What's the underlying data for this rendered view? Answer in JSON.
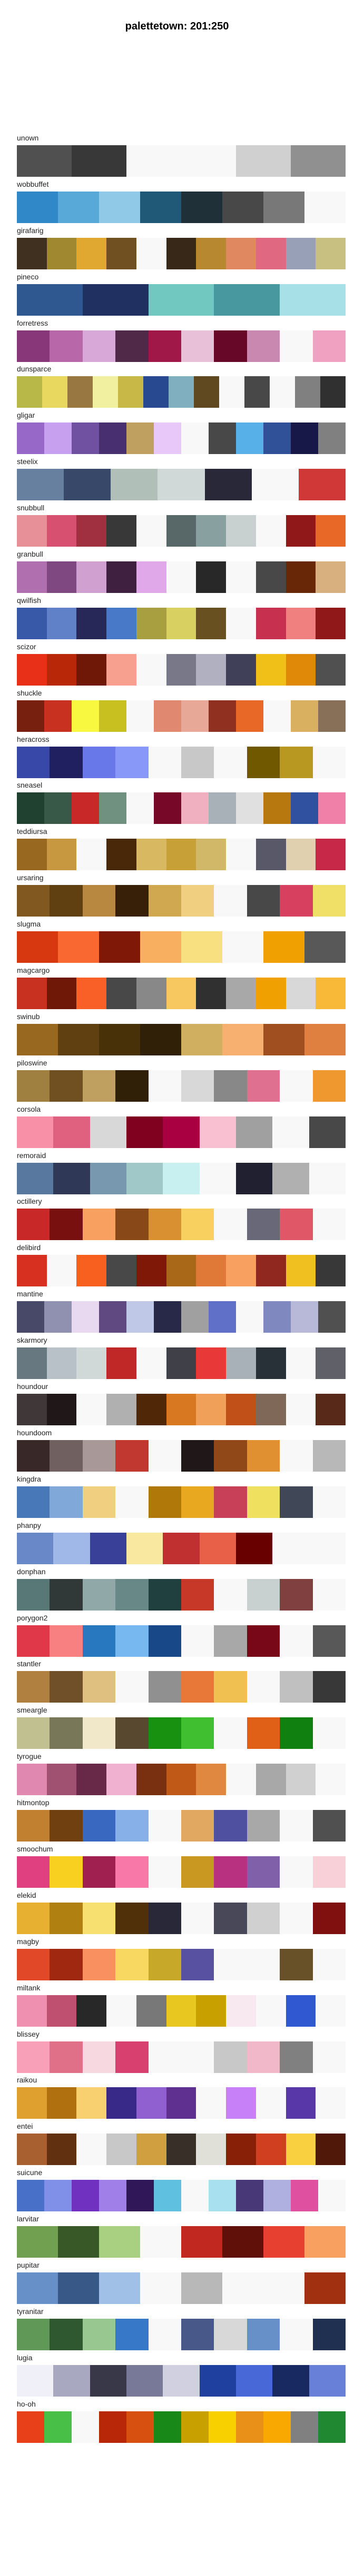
{
  "title": "palettetown: 201:250",
  "palettes": [
    {
      "name": "unown",
      "colors": [
        "#505050",
        "#383838",
        "#f8f8f8",
        "#f8f8f8",
        "#d0d0d0",
        "#909090"
      ]
    },
    {
      "name": "wobbuffet",
      "colors": [
        "#3088c8",
        "#58a8d8",
        "#90c8e8",
        "#205878",
        "#203038",
        "#484848",
        "#787878",
        "#f8f8f8"
      ]
    },
    {
      "name": "girafarig",
      "colors": [
        "#403020",
        "#a08830",
        "#e0a830",
        "#705020",
        "#f8f8f8",
        "#382818",
        "#b88830",
        "#e08860",
        "#e06880",
        "#98a0b8",
        "#c8c080"
      ]
    },
    {
      "name": "pineco",
      "colors": [
        "#305890",
        "#203060",
        "#70c8c0",
        "#4898a0",
        "#a8e0e8"
      ]
    },
    {
      "name": "forretress",
      "colors": [
        "#883878",
        "#b868a8",
        "#d8a8d8",
        "#502848",
        "#a01848",
        "#e8c0d8",
        "#680828",
        "#c888b0",
        "#f8f8f8",
        "#f0a0c0"
      ]
    },
    {
      "name": "dunsparce",
      "colors": [
        "#b8b848",
        "#e8d860",
        "#987840",
        "#f0f0a0",
        "#c8b848",
        "#284890",
        "#80b0c0",
        "#604820",
        "#f8f8f8",
        "#484848",
        "#f8f8f8",
        "#808080",
        "#303030"
      ]
    },
    {
      "name": "gligar",
      "colors": [
        "#9868c8",
        "#c8a0f0",
        "#7050a0",
        "#483070",
        "#c0a060",
        "#e8c8f8",
        "#f8f8f8",
        "#484848",
        "#58b0e8",
        "#305098",
        "#181848",
        "#808080"
      ]
    },
    {
      "name": "steelix",
      "colors": [
        "#6880a0",
        "#384868",
        "#b0c0b8",
        "#d0d8d8",
        "#282838",
        "#f8f8f8",
        "#d03838"
      ]
    },
    {
      "name": "snubbull",
      "colors": [
        "#e89098",
        "#d85070",
        "#a03040",
        "#383838",
        "#f8f8f8",
        "#586868",
        "#88a0a0",
        "#c8d0d0",
        "#f8f8f8",
        "#901818",
        "#e86828"
      ]
    },
    {
      "name": "granbull",
      "colors": [
        "#b070b0",
        "#804880",
        "#d0a0d0",
        "#402040",
        "#e0a8e8",
        "#f8f8f8",
        "#282828",
        "#f8f8f8",
        "#484848",
        "#682808",
        "#d8b080"
      ]
    },
    {
      "name": "qwilfish",
      "colors": [
        "#3858a8",
        "#6080c8",
        "#282858",
        "#4878c8",
        "#a8a040",
        "#d8d060",
        "#685020",
        "#f8f8f8",
        "#c83050",
        "#f08080",
        "#901818"
      ]
    },
    {
      "name": "scizor",
      "colors": [
        "#e83018",
        "#b82808",
        "#701808",
        "#f8a090",
        "#f8f8f8",
        "#787888",
        "#b0b0c0",
        "#404058",
        "#f0c018",
        "#e08808",
        "#505050"
      ]
    },
    {
      "name": "shuckle",
      "colors": [
        "#782010",
        "#c83020",
        "#f8f840",
        "#c8c020",
        "#f8f8f8",
        "#e08870",
        "#e8a898",
        "#903020",
        "#e86828",
        "#f8f8f8",
        "#d8b060",
        "#887058"
      ]
    },
    {
      "name": "heracross",
      "colors": [
        "#3848a8",
        "#202060",
        "#6878e8",
        "#8898f8",
        "#f8f8f8",
        "#c8c8c8",
        "#f8f8f8",
        "#705800",
        "#b89820",
        "#f8f8f8"
      ]
    },
    {
      "name": "sneasel",
      "colors": [
        "#204030",
        "#385848",
        "#c82828",
        "#709080",
        "#f8f8f8",
        "#780828",
        "#f0b0c0",
        "#a8b0b8",
        "#e0e0e0",
        "#b87810",
        "#3050a0",
        "#f080a8"
      ]
    },
    {
      "name": "teddiursa",
      "colors": [
        "#986820",
        "#c89840",
        "#f8f8f8",
        "#482808",
        "#d8b860",
        "#c8a038",
        "#d0b868",
        "#f8f8f8",
        "#585868",
        "#e0d0b0",
        "#c82848"
      ]
    },
    {
      "name": "ursaring",
      "colors": [
        "#805820",
        "#604010",
        "#b88840",
        "#382008",
        "#d0a850",
        "#f0d080",
        "#f8f8f8",
        "#484848",
        "#d84060",
        "#f0e068"
      ]
    },
    {
      "name": "slugma",
      "colors": [
        "#d83810",
        "#f86830",
        "#801808",
        "#f8b060",
        "#f8e080",
        "#f8f8f8",
        "#f0a000",
        "#585858"
      ]
    },
    {
      "name": "magcargo",
      "colors": [
        "#c83020",
        "#701808",
        "#f86028",
        "#484848",
        "#888888",
        "#f8c860",
        "#303030",
        "#a8a8a8",
        "#f0a000",
        "#d8d8d8",
        "#f8b838"
      ]
    },
    {
      "name": "swinub",
      "colors": [
        "#986820",
        "#604010",
        "#483008",
        "#302008",
        "#d0b060",
        "#f8b070",
        "#a05020",
        "#e08040"
      ]
    },
    {
      "name": "piloswine",
      "colors": [
        "#a08040",
        "#705020",
        "#c0a060",
        "#302008",
        "#f8f8f8",
        "#d8d8d8",
        "#888888",
        "#e07090",
        "#f8f8f8",
        "#f09830"
      ]
    },
    {
      "name": "corsola",
      "colors": [
        "#f890a8",
        "#e06080",
        "#d8d8d8",
        "#800020",
        "#a80040",
        "#f8c0d0",
        "#a0a0a0",
        "#f8f8f8",
        "#484848"
      ]
    },
    {
      "name": "remoraid",
      "colors": [
        "#5878a0",
        "#303858",
        "#7898b0",
        "#a0c8c8",
        "#c8f0f0",
        "#f8f8f8",
        "#202030",
        "#b0b0b0",
        "#f8f8f8"
      ]
    },
    {
      "name": "octillery",
      "colors": [
        "#c82828",
        "#781010",
        "#f8a060",
        "#884818",
        "#d89030",
        "#f8d060",
        "#f8f8f8",
        "#686878",
        "#e05868",
        "#f8f8f8"
      ]
    },
    {
      "name": "delibird",
      "colors": [
        "#d83020",
        "#f8f8f8",
        "#f86020",
        "#484848",
        "#801808",
        "#a86818",
        "#e07838",
        "#f8a060",
        "#902820",
        "#f0c020",
        "#383838"
      ]
    },
    {
      "name": "mantine",
      "colors": [
        "#484868",
        "#9090b0",
        "#e8d8f0",
        "#604880",
        "#c0c8e8",
        "#282848",
        "#a0a0a0",
        "#6070c8",
        "#f8f8f8",
        "#8088c0",
        "#b8b8d8",
        "#505050"
      ]
    },
    {
      "name": "skarmory",
      "colors": [
        "#687880",
        "#b8c0c8",
        "#d0d8d8",
        "#c02828",
        "#f8f8f8",
        "#404048",
        "#e83838",
        "#a8b0b8",
        "#283038",
        "#f8f8f8",
        "#606068"
      ]
    },
    {
      "name": "houndour",
      "colors": [
        "#403838",
        "#201818",
        "#f8f8f8",
        "#b0b0b0",
        "#502808",
        "#d87820",
        "#f0a058",
        "#c05018",
        "#806858",
        "#f8f8f8",
        "#582818"
      ]
    },
    {
      "name": "houndoom",
      "colors": [
        "#382828",
        "#706060",
        "#a89898",
        "#c03830",
        "#f8f8f8",
        "#201818",
        "#904818",
        "#e09030",
        "#f8f8f8",
        "#b8b8b8"
      ]
    },
    {
      "name": "kingdra",
      "colors": [
        "#4878b8",
        "#80a8d8",
        "#f0d080",
        "#f8f8f8",
        "#b07808",
        "#e8a820",
        "#c84058",
        "#f0e060",
        "#404858",
        "#f8f8f8"
      ]
    },
    {
      "name": "phanpy",
      "colors": [
        "#6888c8",
        "#a0b8e8",
        "#384098",
        "#f8e8a0",
        "#c03030",
        "#e86048",
        "#680000",
        "#f8f8f8",
        "#f8f8f8"
      ]
    },
    {
      "name": "donphan",
      "colors": [
        "#587878",
        "#303838",
        "#90a8a8",
        "#688888",
        "#204040",
        "#c83828",
        "#f8f8f8",
        "#c8d0d0",
        "#804040",
        "#f8f8f8"
      ]
    },
    {
      "name": "porygon2",
      "colors": [
        "#e03848",
        "#f88080",
        "#2878c0",
        "#78b8f0",
        "#184888",
        "#f8f8f8",
        "#a8a8a8",
        "#780818",
        "#f8f8f8",
        "#585858"
      ]
    },
    {
      "name": "stantler",
      "colors": [
        "#b08040",
        "#705028",
        "#e0c080",
        "#f8f8f8",
        "#909090",
        "#e87838",
        "#f0c050",
        "#f8f8f8",
        "#c0c0c0",
        "#383838"
      ]
    },
    {
      "name": "smeargle",
      "colors": [
        "#c0c090",
        "#787858",
        "#f0e8c8",
        "#584830",
        "#189010",
        "#40c030",
        "#f8f8f8",
        "#e06018",
        "#108010",
        "#f8f8f8"
      ]
    },
    {
      "name": "tyrogue",
      "colors": [
        "#e088b0",
        "#a05070",
        "#682848",
        "#f0b0d0",
        "#783010",
        "#c05818",
        "#e08840",
        "#f8f8f8",
        "#a8a8a8",
        "#d0d0d0",
        "#f8f8f8"
      ]
    },
    {
      "name": "hitmontop",
      "colors": [
        "#c08030",
        "#704010",
        "#3868c0",
        "#88b0e8",
        "#f8f8f8",
        "#e0a860",
        "#5050a0",
        "#a8a8a8",
        "#f8f8f8",
        "#505050"
      ]
    },
    {
      "name": "smoochum",
      "colors": [
        "#e04080",
        "#f8d020",
        "#a02050",
        "#f878a8",
        "#f8f8f8",
        "#c89820",
        "#b83080",
        "#8060a8",
        "#f8f8f8",
        "#f8d0d8"
      ]
    },
    {
      "name": "elekid",
      "colors": [
        "#e8b030",
        "#b08010",
        "#f8e070",
        "#503008",
        "#282838",
        "#f8f8f8",
        "#484858",
        "#d0d0d0",
        "#f8f8f8",
        "#801010"
      ]
    },
    {
      "name": "magby",
      "colors": [
        "#e04828",
        "#a02810",
        "#f89060",
        "#f8d860",
        "#c8a828",
        "#5850a0",
        "#f8f8f8",
        "#f8f8f8",
        "#685028",
        "#f8f8f8"
      ]
    },
    {
      "name": "miltank",
      "colors": [
        "#f090b0",
        "#c05070",
        "#282828",
        "#f8f8f8",
        "#787878",
        "#e8c820",
        "#c8a000",
        "#f8e8f0",
        "#f8f8f8",
        "#3058d0",
        "#f8f8f8"
      ]
    },
    {
      "name": "blissey",
      "colors": [
        "#f8a0b8",
        "#e07088",
        "#f8d8e0",
        "#d84070",
        "#f8f8f8",
        "#f8f8f8",
        "#c8c8c8",
        "#f0b8c8",
        "#808080",
        "#f8f8f8"
      ]
    },
    {
      "name": "raikou",
      "colors": [
        "#e0a030",
        "#b07010",
        "#f8d070",
        "#382888",
        "#9060d0",
        "#603090",
        "#f8f8f8",
        "#c880f8",
        "#f8f8f8",
        "#5838a8",
        "#f8f8f8"
      ]
    },
    {
      "name": "entei",
      "colors": [
        "#a86030",
        "#603010",
        "#f8f8f8",
        "#c8c8c8",
        "#d0a040",
        "#383028",
        "#e0e0d8",
        "#882008",
        "#d04020",
        "#f8d040",
        "#501808"
      ]
    },
    {
      "name": "suicune",
      "colors": [
        "#4870c8",
        "#8090e8",
        "#7030c0",
        "#a080e8",
        "#301858",
        "#60c0e0",
        "#f8f8f8",
        "#a8e0f0",
        "#483878",
        "#b0b0e0",
        "#e050a0",
        "#f8f8f8"
      ]
    },
    {
      "name": "larvitar",
      "colors": [
        "#70a050",
        "#385828",
        "#a8d080",
        "#f8f8f8",
        "#c02820",
        "#601008",
        "#e84030",
        "#f8a060"
      ]
    },
    {
      "name": "pupitar",
      "colors": [
        "#6890c8",
        "#385888",
        "#a0c0e8",
        "#f8f8f8",
        "#b8b8b8",
        "#f8f8f8",
        "#f8f8f8",
        "#a03010"
      ]
    },
    {
      "name": "tyranitar",
      "colors": [
        "#609858",
        "#305830",
        "#98c890",
        "#3878c8",
        "#f8f8f8",
        "#485888",
        "#d8d8d8",
        "#6890c8",
        "#f8f8f8",
        "#203050"
      ]
    },
    {
      "name": "lugia",
      "colors": [
        "#f0f0f8",
        "#a8a8c0",
        "#383848",
        "#787898",
        "#d0d0e0",
        "#2040a0",
        "#4868d8",
        "#182860",
        "#6880d8"
      ]
    },
    {
      "name": "ho-oh",
      "colors": [
        "#e84018",
        "#48c048",
        "#f8f8f8",
        "#b82808",
        "#d85010",
        "#188818",
        "#c8a000",
        "#f8d000",
        "#e89018",
        "#f8a800",
        "#808080",
        "#208830"
      ]
    }
  ]
}
